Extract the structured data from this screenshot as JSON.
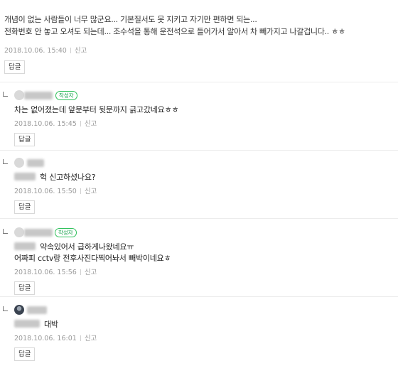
{
  "top_comment": {
    "line1": "개념이 없는 사람들이 너무 많군요... 기본질서도 못 지키고 자기만 편하면 되는...",
    "line2": "전화번호 안 놓고 오셔도 되는데... 조수석을 통해 운전석으로 들어가서 알아서 차 빼가지고 나갈겁니다.. ㅎㅎ",
    "date": "2018.10.06. 15:40",
    "report": "신고",
    "reply_button": "답글"
  },
  "replies": [
    {
      "badge": "작성자",
      "text": "차는 없어졌는데 앞문부터 뒷문까지 긁고갔네요ㅎㅎ",
      "date": "2018.10.06. 15:45",
      "report": "신고",
      "reply_button": "답글"
    },
    {
      "text": "헉 신고하셨나요?",
      "date": "2018.10.06. 15:50",
      "report": "신고",
      "reply_button": "답글"
    },
    {
      "badge": "작성자",
      "text": "약속있어서 급하게나왔네요ㅠ",
      "text2": "어짜피 cctv랑 전후사진다찍어놔서 빼박이네요ㅎ",
      "date": "2018.10.06. 15:56",
      "report": "신고",
      "reply_button": "답글"
    },
    {
      "text": "대박",
      "date": "2018.10.06. 16:01",
      "report": "신고",
      "reply_button": "답글"
    }
  ]
}
